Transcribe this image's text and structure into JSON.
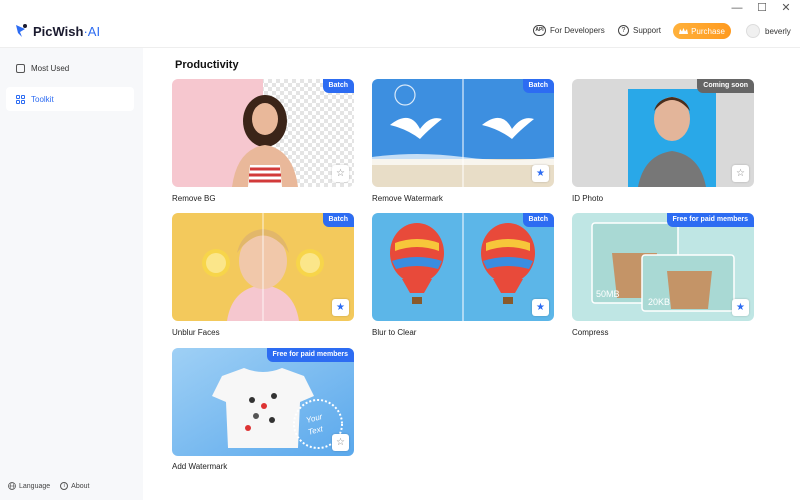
{
  "app": {
    "name": "PicWish",
    "name_suffix": "·AI"
  },
  "window": {
    "minimize": "—",
    "maximize": "☐",
    "close": "✕"
  },
  "header": {
    "developers_icon_text": "API",
    "developers_label": "For Developers",
    "support_icon_text": "?",
    "support_label": "Support",
    "purchase_label": "Purchase",
    "username": "beverly"
  },
  "sidebar": {
    "items": [
      {
        "label": "Most Used",
        "active": false
      },
      {
        "label": "Toolkit",
        "active": true
      }
    ],
    "footer": {
      "language": "Language",
      "about_icon": "i",
      "about": "About"
    }
  },
  "main": {
    "section_title": "Productivity",
    "cards": [
      {
        "label": "Remove BG",
        "badge": "Batch",
        "favorite": false
      },
      {
        "label": "Remove Watermark",
        "badge": "Batch",
        "favorite": true
      },
      {
        "label": "ID Photo",
        "badge": "Coming soon",
        "favorite": false
      },
      {
        "label": "Unblur Faces",
        "badge": "Batch",
        "favorite": true
      },
      {
        "label": "Blur to Clear",
        "badge": "Batch",
        "favorite": true
      },
      {
        "label": "Compress",
        "badge": "Free for paid members",
        "favorite": true,
        "size_before": "50MB",
        "size_after": "20KB"
      },
      {
        "label": "Add Watermark",
        "badge": "Free for paid members",
        "favorite": false,
        "stamp_text_1": "Your",
        "stamp_text_2": "Text"
      }
    ]
  },
  "colors": {
    "accent": "#2d6cf2",
    "purchase": "#ff9a1f",
    "sidebar_bg": "#f7f8fa"
  }
}
